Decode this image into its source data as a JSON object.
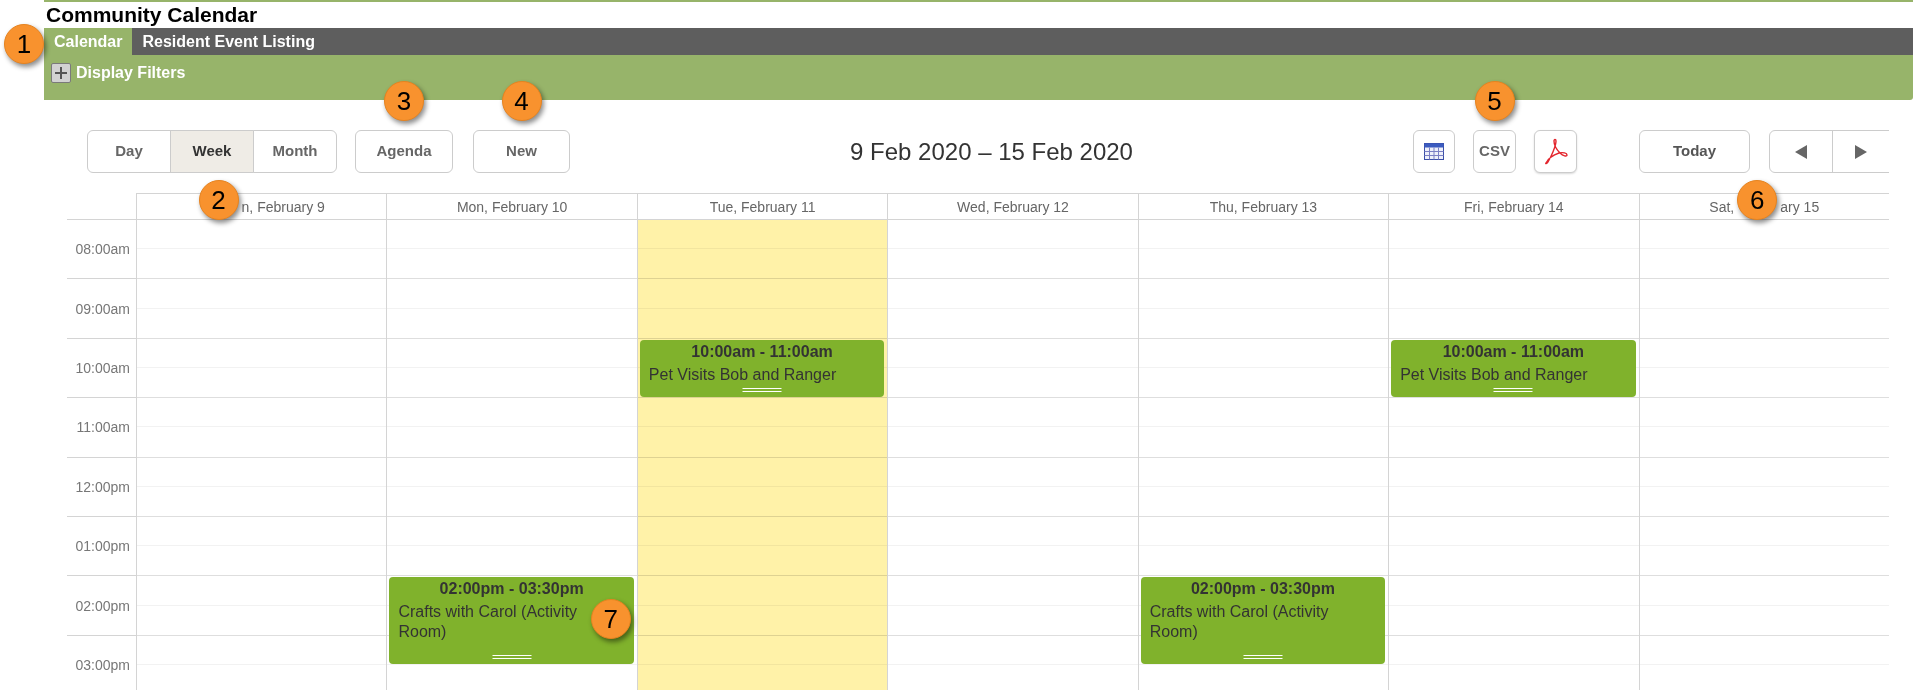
{
  "page": {
    "title": "Community Calendar"
  },
  "nav": {
    "callout": "1",
    "tabs": [
      {
        "label": "Calendar",
        "selected": true
      },
      {
        "label": "Resident Event Listing",
        "selected": false
      }
    ]
  },
  "filters": {
    "label": "Display Filters",
    "expanded": false
  },
  "toolbar": {
    "views": [
      {
        "label": "Day",
        "selected": false
      },
      {
        "label": "Week",
        "selected": true
      },
      {
        "label": "Month",
        "selected": false
      }
    ],
    "agenda": {
      "label": "Agenda",
      "callout": "3"
    },
    "new": {
      "label": "New",
      "callout": "4"
    },
    "range": "9 Feb 2020 – 15 Feb 2020",
    "exports": {
      "callout": "5",
      "csv": "CSV"
    },
    "today": "Today"
  },
  "calendar": {
    "hours": [
      "08:00am",
      "09:00am",
      "10:00am",
      "11:00am",
      "12:00pm",
      "01:00pm",
      "02:00pm",
      "03:00pm"
    ],
    "days": [
      {
        "header": [
          {
            "kind": "callout",
            "label": "2"
          },
          {
            "kind": "text",
            "label": "n, February 9"
          }
        ],
        "today": false
      },
      {
        "header": [
          {
            "kind": "text",
            "label": "Mon, February 10"
          }
        ],
        "today": false,
        "events": [
          {
            "time": "02:00pm - 03:30pm",
            "title": "Crafts with Carol (Activity Room)",
            "callout": "7"
          }
        ]
      },
      {
        "header": [
          {
            "kind": "text",
            "label": "Tue, February 11"
          }
        ],
        "today": true,
        "events": [
          {
            "time": "10:00am - 11:00am",
            "title": "Pet Visits Bob and Ranger"
          }
        ]
      },
      {
        "header": [
          {
            "kind": "text",
            "label": "Wed, February 12"
          }
        ],
        "today": false
      },
      {
        "header": [
          {
            "kind": "text",
            "label": "Thu, February 13"
          }
        ],
        "today": false,
        "events": [
          {
            "time": "02:00pm - 03:30pm",
            "title": "Crafts with Carol (Activity Room)"
          }
        ]
      },
      {
        "header": [
          {
            "kind": "text",
            "label": "Fri, February 14"
          }
        ],
        "today": false,
        "events": [
          {
            "time": "10:00am - 11:00am",
            "title": "Pet Visits Bob and Ranger"
          }
        ]
      },
      {
        "header": [
          {
            "kind": "text",
            "label": "Sat,"
          },
          {
            "kind": "callout",
            "label": "6"
          },
          {
            "kind": "text",
            "label": "ary 15"
          }
        ],
        "today": false
      }
    ]
  }
}
